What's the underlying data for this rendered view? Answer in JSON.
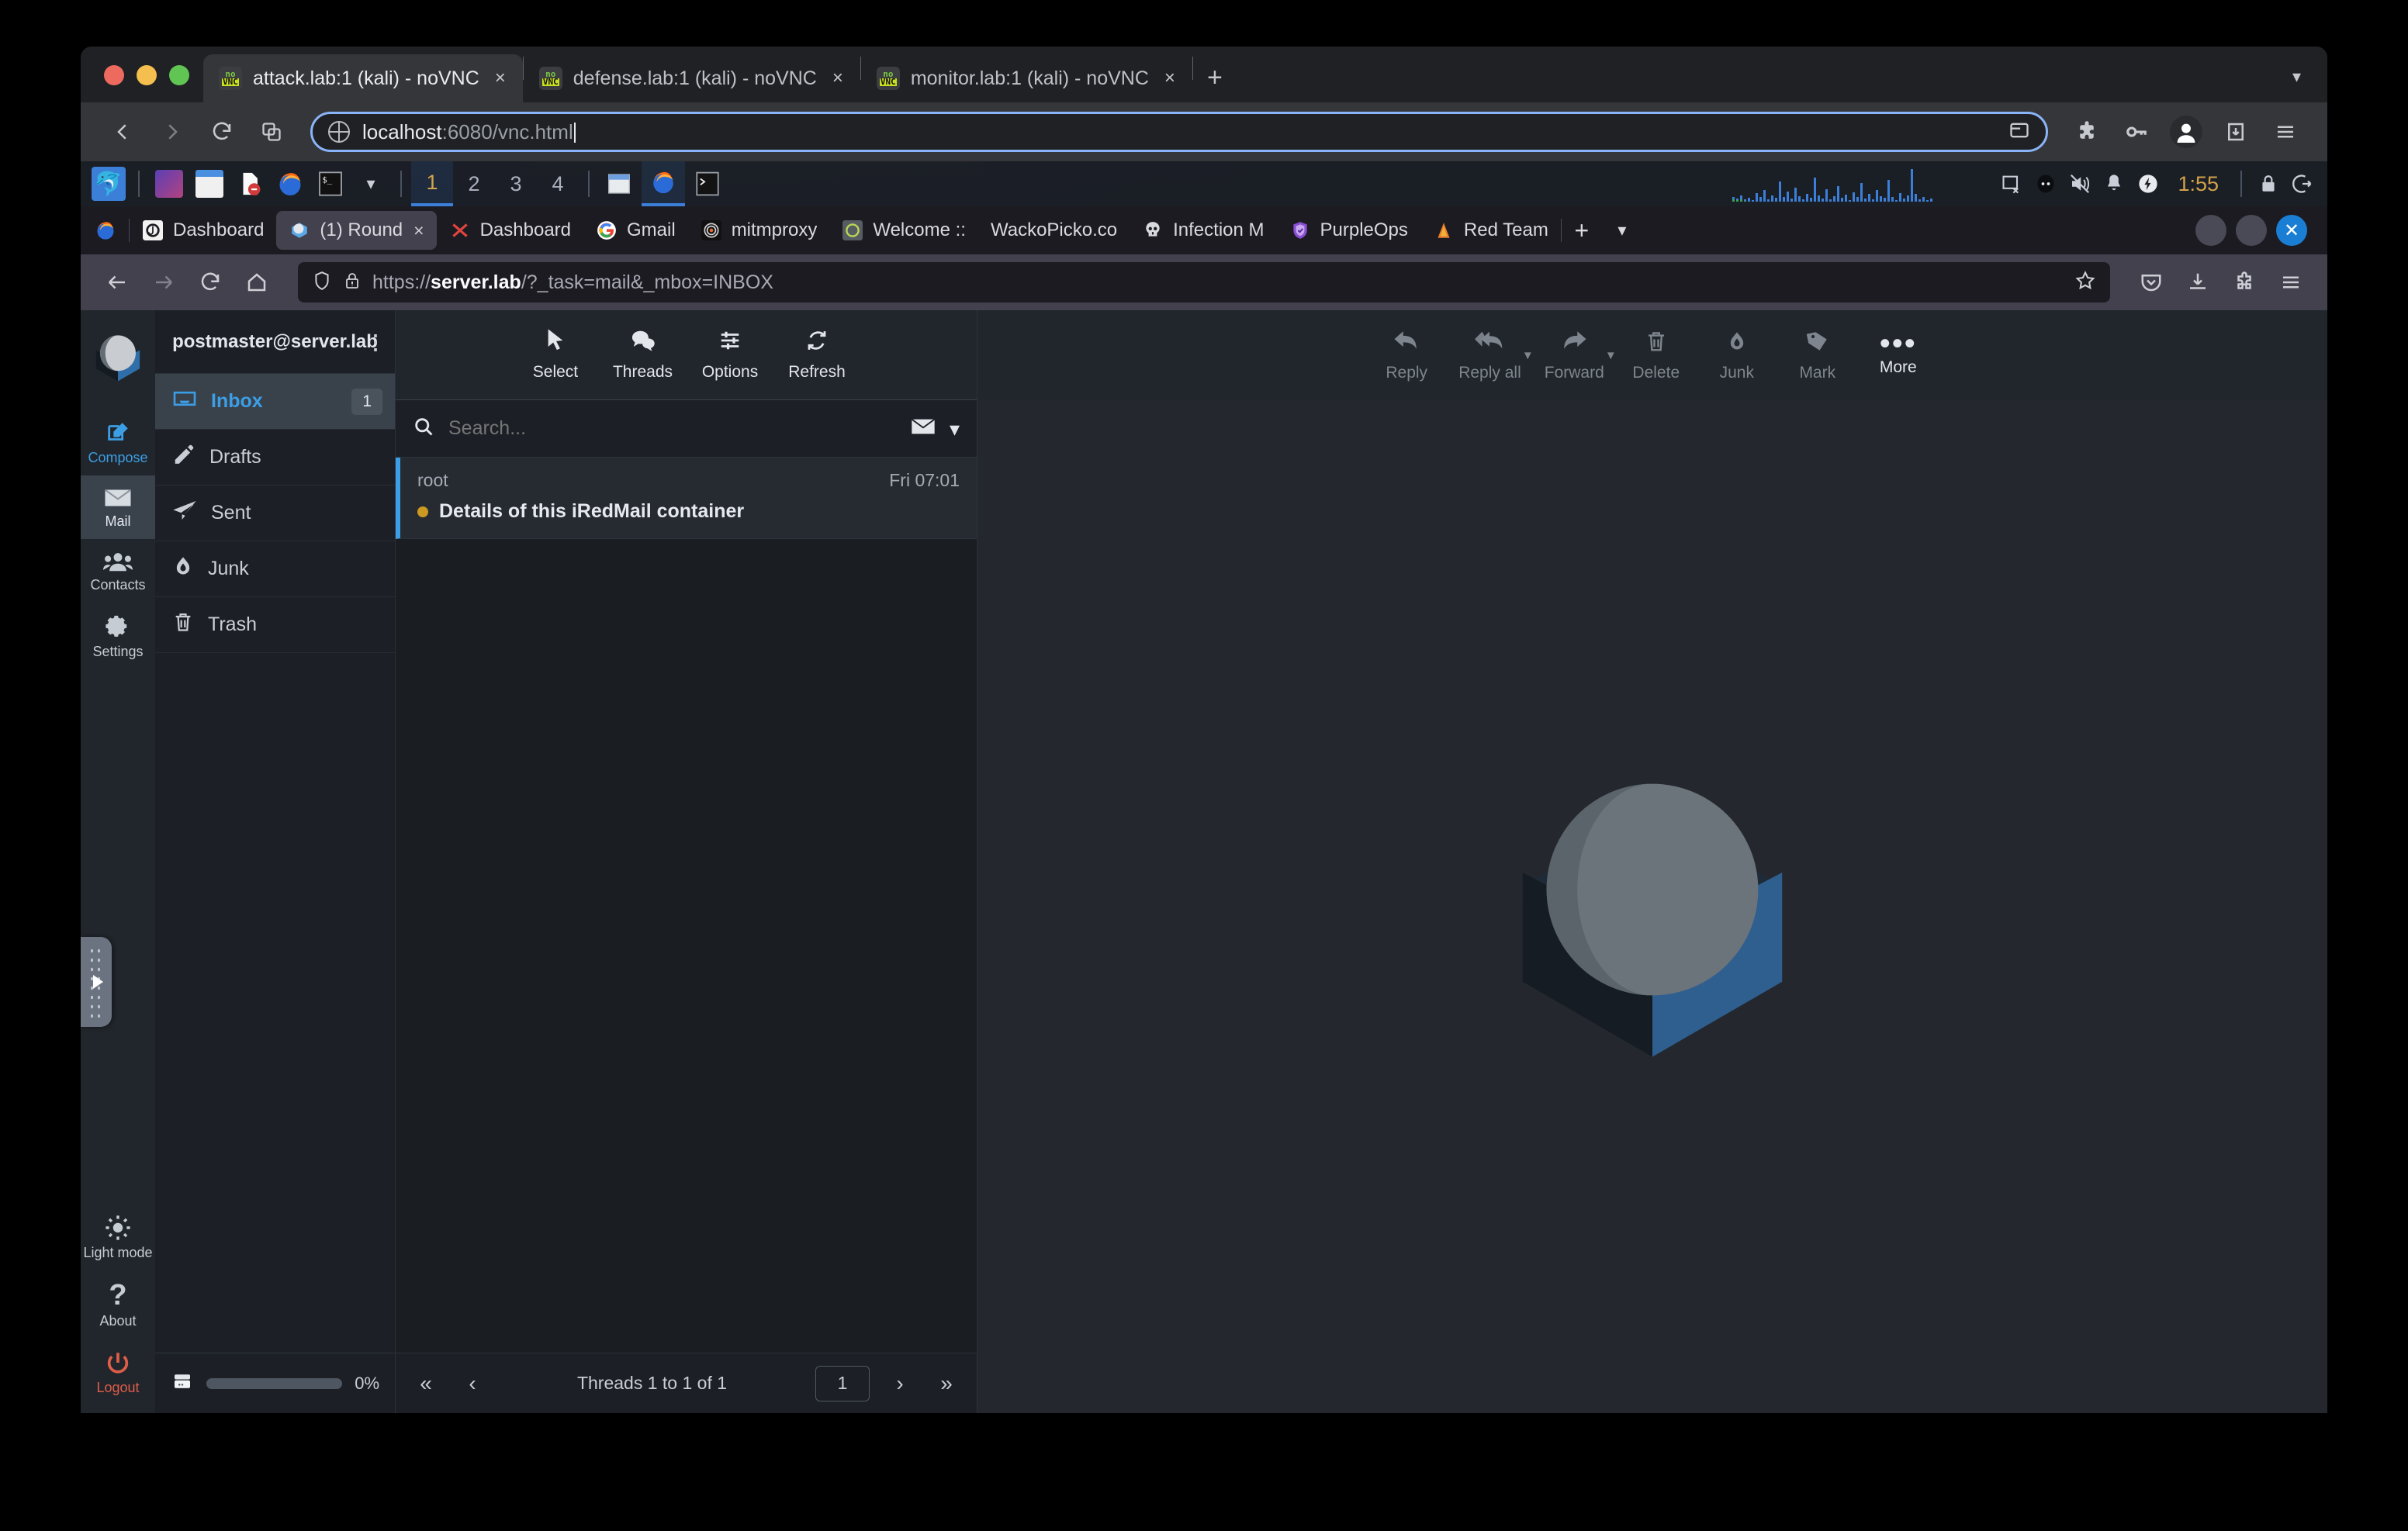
{
  "chrome": {
    "tabs": [
      {
        "title": "attack.lab:1 (kali) - noVNC",
        "icon": "novnc-icon",
        "active": true
      },
      {
        "title": "defense.lab:1 (kali) - noVNC",
        "icon": "novnc-icon",
        "active": false
      },
      {
        "title": "monitor.lab:1 (kali) - noVNC",
        "icon": "novnc-icon",
        "active": false
      }
    ],
    "close_label": "×",
    "newtab_label": "+",
    "url_host": "localhost",
    "url_rest": ":6080/vnc.html",
    "toolbar_icons": [
      "back-icon",
      "forward-icon",
      "reload-icon",
      "tab-search-icon",
      "share-icon",
      "extensions-icon",
      "password-key-icon",
      "profile-avatar-icon",
      "download-icon",
      "chrome-menu-icon"
    ]
  },
  "kali_panel": {
    "logo": "kali-dragon-icon",
    "launchers": [
      "terminal-emulator-icon",
      "file-manager-icon",
      "text-editor-icon",
      "firefox-icon",
      "terminal-icon",
      "show-applications-chevron"
    ],
    "workspaces": [
      "1",
      "2",
      "3",
      "4"
    ],
    "window_buttons": [
      "window-icon",
      "firefox-window-icon",
      "terminal-window-icon"
    ],
    "tray": [
      "cpu-graph-icon",
      "screenshot-icon",
      "user-face-icon",
      "volume-muted-icon",
      "notification-bell-icon",
      "power-manager-icon"
    ],
    "clock": "1:55",
    "session_icons": [
      "lock-screen-icon",
      "logout-icon"
    ]
  },
  "firefox": {
    "tabs": [
      {
        "title": "Dashboard",
        "icon": "jenkins-icon",
        "active": false
      },
      {
        "title": "(1) Round",
        "icon": "roundcube-icon",
        "active": true
      },
      {
        "title": "Dashboard",
        "icon": "red-x-icon",
        "active": false
      },
      {
        "title": "Gmail",
        "icon": "google-icon",
        "active": false
      },
      {
        "title": "mitmproxy",
        "icon": "mitmproxy-icon",
        "active": false
      },
      {
        "title": "Welcome ::",
        "icon": "welcome-icon",
        "active": false
      },
      {
        "title": "WackoPicko.co",
        "icon": "wackopicko-icon",
        "active": false
      },
      {
        "title": "Infection M",
        "icon": "skull-icon",
        "active": false
      },
      {
        "title": "PurpleOps",
        "icon": "shield-icon",
        "active": false
      },
      {
        "title": "Red Team",
        "icon": "redteam-icon",
        "active": false
      }
    ],
    "tab_close_label": "×",
    "newtab_label": "+",
    "list_all_tabs_label": "⌄",
    "url_scheme": "https://",
    "url_host": "server.lab",
    "url_path": "/?_task=mail&_mbox=INBOX",
    "nav_icons": [
      "back-icon",
      "forward-icon",
      "reload-icon",
      "home-icon",
      "tracking-shield-icon",
      "insecure-lock-icon",
      "bookmark-star-icon",
      "pocket-icon",
      "downloads-icon",
      "extensions-icon",
      "firefox-menu-icon"
    ]
  },
  "roundcube": {
    "tasks": [
      {
        "label": "Compose",
        "icon": "compose-icon",
        "state": "accent"
      },
      {
        "label": "Mail",
        "icon": "envelope-icon",
        "state": "active"
      },
      {
        "label": "Contacts",
        "icon": "contacts-icon",
        "state": "normal"
      },
      {
        "label": "Settings",
        "icon": "gear-icon",
        "state": "normal"
      },
      {
        "label": "Light mode",
        "icon": "sun-icon",
        "state": "normal"
      },
      {
        "label": "About",
        "icon": "question-mark-icon",
        "state": "normal"
      },
      {
        "label": "Logout",
        "icon": "power-icon",
        "state": "danger"
      }
    ],
    "account": "postmaster@server.lab",
    "folder_options_icon": "more-vertical-icon",
    "folders": [
      {
        "label": "Inbox",
        "icon": "inbox-icon",
        "badge": "1",
        "active": true
      },
      {
        "label": "Drafts",
        "icon": "pencil-icon",
        "badge": "",
        "active": false
      },
      {
        "label": "Sent",
        "icon": "paper-plane-icon",
        "badge": "",
        "active": false
      },
      {
        "label": "Junk",
        "icon": "flame-icon",
        "badge": "",
        "active": false
      },
      {
        "label": "Trash",
        "icon": "trash-icon",
        "badge": "",
        "active": false
      }
    ],
    "quota": {
      "icon": "disk-quota-icon",
      "percent": "0%",
      "value": 0
    },
    "list_toolbar": [
      {
        "label": "Select",
        "icon": "cursor-arrow-icon"
      },
      {
        "label": "Threads",
        "icon": "threads-icon"
      },
      {
        "label": "Options",
        "icon": "sliders-icon"
      },
      {
        "label": "Refresh",
        "icon": "refresh-icon"
      }
    ],
    "search": {
      "placeholder": "Search...",
      "value": "",
      "icon": "search-icon",
      "scope_icon": "envelope-icon",
      "dropdown_icon": "chevron-down-icon"
    },
    "messages": [
      {
        "from": "root",
        "date": "Fri 07:01",
        "subject": "Details of this iRedMail container",
        "unread": true,
        "flag_color": "#cc9a22"
      }
    ],
    "pagination": {
      "first_icon": "«",
      "prev_icon": "‹",
      "count_text": "Threads 1 to 1 of 1",
      "page_value": "1",
      "next_icon": "›",
      "last_icon": "»"
    },
    "content_toolbar": [
      {
        "label": "Reply",
        "icon": "reply-icon",
        "enabled": false,
        "has_arrow": false
      },
      {
        "label": "Reply all",
        "icon": "reply-all-icon",
        "enabled": false,
        "has_arrow": true
      },
      {
        "label": "Forward",
        "icon": "forward-icon",
        "enabled": false,
        "has_arrow": true
      },
      {
        "label": "Delete",
        "icon": "trash-icon",
        "enabled": false,
        "has_arrow": false
      },
      {
        "label": "Junk",
        "icon": "flame-icon",
        "enabled": false,
        "has_arrow": false
      },
      {
        "label": "Mark",
        "icon": "tag-icon",
        "enabled": false,
        "has_arrow": false
      },
      {
        "label": "More",
        "icon": "more-horizontal-icon",
        "enabled": true,
        "has_arrow": false
      }
    ],
    "watermark_icon": "roundcube-logo-icon",
    "accent_color": "#3c9ee5",
    "danger_color": "#e05d4a"
  },
  "novnc": {
    "drag_handle_icon": "novnc-drag-handle-icon"
  }
}
